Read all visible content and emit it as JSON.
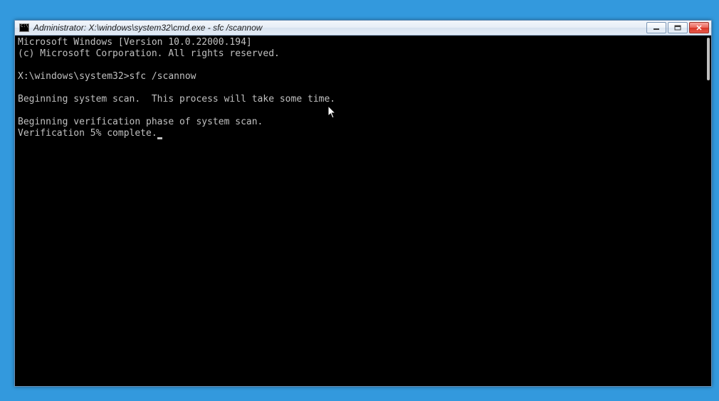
{
  "window": {
    "title": "Administrator: X:\\windows\\system32\\cmd.exe - sfc  /scannow"
  },
  "console": {
    "line1": "Microsoft Windows [Version 10.0.22000.194]",
    "line2": "(c) Microsoft Corporation. All rights reserved.",
    "blank1": "",
    "prompt": "X:\\windows\\system32>",
    "command": "sfc /scannow",
    "blank2": "",
    "line3": "Beginning system scan.  This process will take some time.",
    "blank3": "",
    "line4": "Beginning verification phase of system scan.",
    "line5": "Verification 5% complete."
  },
  "colors": {
    "desktop_bg": "#3399dd",
    "console_bg": "#000000",
    "console_fg": "#c0c0c0",
    "close_btn": "#d93425"
  }
}
